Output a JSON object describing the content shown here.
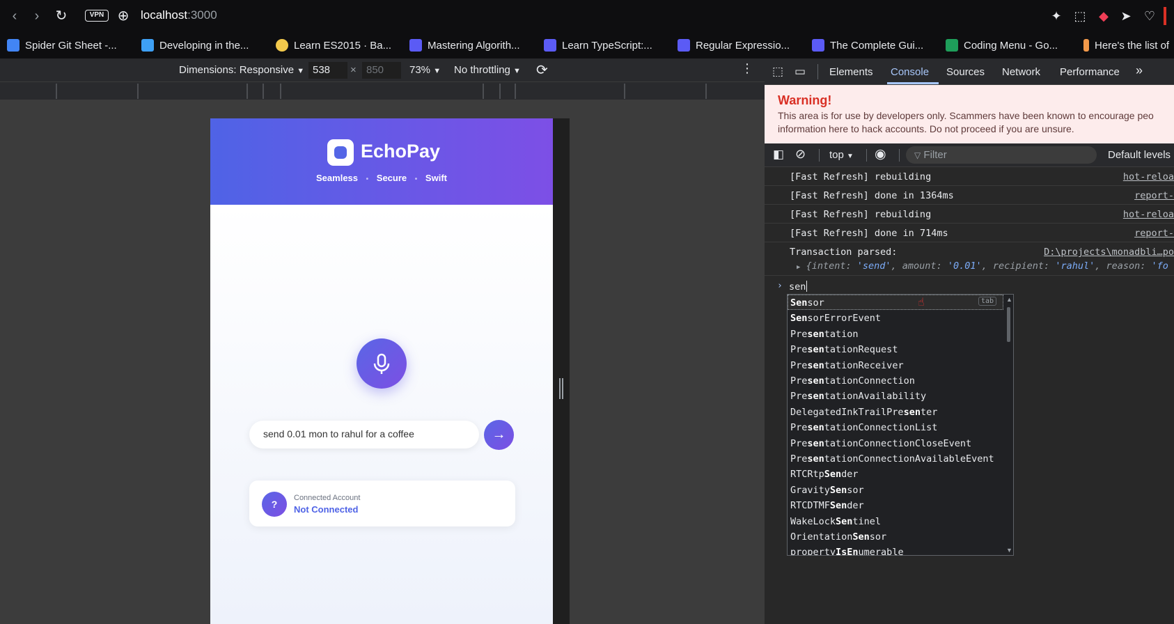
{
  "browser": {
    "vpn_label": "VPN",
    "url_host": "localhost",
    "url_port": ":3000"
  },
  "bookmarks": [
    {
      "label": "Spider Git Sheet -...",
      "color": "#4285f4"
    },
    {
      "label": "Developing in the...",
      "color": "#3ea0f5"
    },
    {
      "label": "Learn ES2015 · Ba...",
      "color": "#f2c94c"
    },
    {
      "label": "Mastering Algorith...",
      "color": "#5b5bf5"
    },
    {
      "label": "Learn TypeScript:...",
      "color": "#5b5bf5"
    },
    {
      "label": "Regular Expressio...",
      "color": "#5b5bf5"
    },
    {
      "label": "The Complete Gui...",
      "color": "#5b5bf5"
    },
    {
      "label": "Coding Menu - Go...",
      "color": "#1e9e5a"
    },
    {
      "label": "Here's the list of",
      "color": "#f2994a"
    }
  ],
  "device_toolbar": {
    "dimensions_label": "Dimensions: Responsive",
    "width_value": "538",
    "times": "×",
    "height_value": "850",
    "zoom": "73%",
    "throttling": "No throttling"
  },
  "app": {
    "brand": "EchoPay",
    "tagline_1": "Seamless",
    "tagline_2": "Secure",
    "tagline_3": "Swift",
    "dot": "•",
    "command_input_value": "send 0.01 mon to rahul for a coffee",
    "account_label": "Connected Account",
    "account_status": "Not Connected",
    "account_icon_text": "?"
  },
  "devtools": {
    "tabs": [
      "Elements",
      "Console",
      "Sources",
      "Network",
      "Performance"
    ],
    "active_tab": "Console",
    "more_tabs": "»",
    "warning_title": "Warning!",
    "warning_line1": "This area is for use by developers only. Scammers have been known to encourage peo",
    "warning_line2": "information here to hack accounts. Do not proceed if you are unsure.",
    "context": "top",
    "filter_placeholder": "Filter",
    "levels": "Default levels",
    "logs": [
      {
        "msg": "[Fast Refresh] rebuilding",
        "src": "hot-reloa"
      },
      {
        "msg": "[Fast Refresh] done in 1364ms",
        "src": "report-"
      },
      {
        "msg": "[Fast Refresh] rebuilding",
        "src": "hot-reloa"
      },
      {
        "msg": "[Fast Refresh] done in 714ms",
        "src": "report-"
      }
    ],
    "tx_label": "Transaction parsed:",
    "tx_src": "D:\\projects\\monadbli…po",
    "tx_object": {
      "open": "{",
      "k1": "intent",
      "v1": "'send'",
      "k2": "amount",
      "v2": "'0.01'",
      "k3": "recipient",
      "v3": "'rahul'",
      "k4": "reason",
      "v4": "'fo"
    },
    "prompt_input": "sen",
    "tab_hint": "tab",
    "autocomplete": [
      {
        "pre": "",
        "match": "Sen",
        "post": "sor"
      },
      {
        "pre": "",
        "match": "Sen",
        "post": "sorErrorEvent"
      },
      {
        "pre": "Pre",
        "match": "sen",
        "post": "tation"
      },
      {
        "pre": "Pre",
        "match": "sen",
        "post": "tationRequest"
      },
      {
        "pre": "Pre",
        "match": "sen",
        "post": "tationReceiver"
      },
      {
        "pre": "Pre",
        "match": "sen",
        "post": "tationConnection"
      },
      {
        "pre": "Pre",
        "match": "sen",
        "post": "tationAvailability"
      },
      {
        "pre": "DelegatedInkTrailPre",
        "match": "sen",
        "post": "ter"
      },
      {
        "pre": "Pre",
        "match": "sen",
        "post": "tationConnectionList"
      },
      {
        "pre": "Pre",
        "match": "sen",
        "post": "tationConnectionCloseEvent"
      },
      {
        "pre": "Pre",
        "match": "sen",
        "post": "tationConnectionAvailableEvent"
      },
      {
        "pre": "RTCRtp",
        "match": "Sen",
        "post": "der"
      },
      {
        "pre": "Gravity",
        "match": "Sen",
        "post": "sor"
      },
      {
        "pre": "RTCDTMF",
        "match": "Sen",
        "post": "der"
      },
      {
        "pre": "WakeLock",
        "match": "Sen",
        "post": "tinel"
      },
      {
        "pre": "Orientation",
        "match": "Sen",
        "post": "sor"
      },
      {
        "pre": "property",
        "match": "IsEn",
        "post": "umerable"
      }
    ]
  },
  "colors": {
    "accent": "#7cacf8",
    "warning_red": "#d93025",
    "brand_gradient_start": "#4f63e6",
    "brand_gradient_end": "#7d4fe6"
  }
}
